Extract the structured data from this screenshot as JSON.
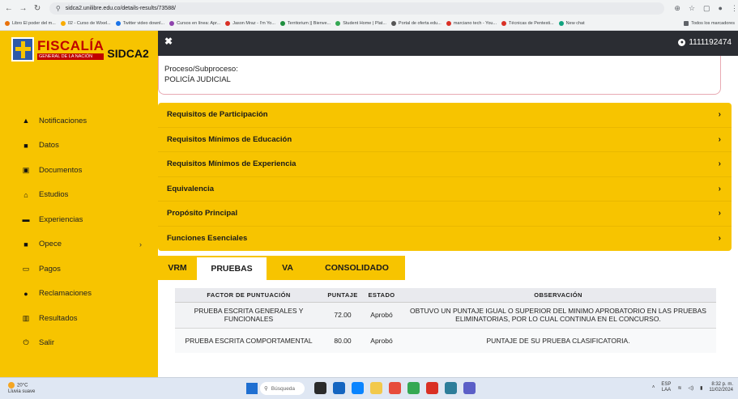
{
  "browser": {
    "url": "sidca2.unilibre.edu.co/details-results/73588/",
    "bookmarks": [
      "Libro El poder del m...",
      "02 - Curso de Wixel...",
      "Twitter video downl...",
      "Cursos en línea: Apr...",
      "Jason Mraz - I'm Yo...",
      "Territorium || Bienve...",
      "Student Home | Plat...",
      "Portal de oferta edu...",
      "marciano tech - You...",
      "Técnicas de Pentesti...",
      "New chat"
    ],
    "all_bookmarks": "Todos los marcadores"
  },
  "logo": {
    "name": "FISCALÍA",
    "subtitle": "GENERAL DE LA NACIÓN",
    "app": "SIDCA2"
  },
  "topbar": {
    "close": "✖",
    "user_id": "1111192474"
  },
  "sidebar": {
    "items": [
      {
        "label": "Notificaciones",
        "icon": "bell-icon"
      },
      {
        "label": "Datos",
        "icon": "id-card-icon"
      },
      {
        "label": "Documentos",
        "icon": "documents-icon"
      },
      {
        "label": "Estudios",
        "icon": "graduation-icon"
      },
      {
        "label": "Experiencias",
        "icon": "briefcase-icon"
      },
      {
        "label": "Opece",
        "icon": "folder-icon",
        "arrow": "›"
      },
      {
        "label": "Pagos",
        "icon": "payment-icon"
      },
      {
        "label": "Reclamaciones",
        "icon": "comment-icon"
      },
      {
        "label": "Resultados",
        "icon": "chart-icon"
      },
      {
        "label": "Salir",
        "icon": "power-icon"
      }
    ]
  },
  "process": {
    "label": "Proceso/Subproceso:",
    "value": "POLICÍA JUDICIAL"
  },
  "accordion": [
    "Requisitos de Participación",
    "Requisitos Mínimos de Educación",
    "Requisitos Mínimos de Experiencia",
    "Equivalencia",
    "Propósito Principal",
    "Funciones Esenciales"
  ],
  "tabs": [
    "VRM",
    "PRUEBAS",
    "VA",
    "CONSOLIDADO"
  ],
  "results_table": {
    "headers": [
      "FACTOR DE PUNTUACIÓN",
      "PUNTAJE",
      "ESTADO",
      "OBSERVACIÓN"
    ],
    "rows": [
      [
        "PRUEBA ESCRITA GENERALES Y FUNCIONALES",
        "72.00",
        "Aprobó",
        "OBTUVO UN PUNTAJE IGUAL O SUPERIOR DEL MINIMO APROBATORIO EN LAS PRUEBAS ELIMINATORIAS, POR LO CUAL CONTINUA EN EL CONCURSO."
      ],
      [
        "PRUEBA ESCRITA COMPORTAMENTAL",
        "80.00",
        "Aprobó",
        "PUNTAJE DE SU PRUEBA CLASIFICATORIA."
      ]
    ]
  },
  "taskbar": {
    "weather_temp": "20°C",
    "weather_desc": "Lluvia suave",
    "search": "Búsqueda",
    "lang": "ESP",
    "region": "LAA",
    "time": "8:32 p. m.",
    "date": "11/02/2024"
  },
  "colors": {
    "accent": "#f7c400",
    "topbar": "#2b2d33",
    "brand_red": "#c00000"
  }
}
